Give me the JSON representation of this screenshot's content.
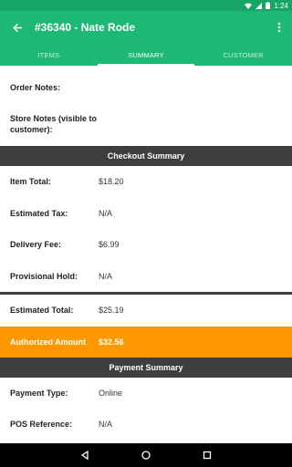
{
  "status_bar": {
    "time": "1:24"
  },
  "app_bar": {
    "title": "#36340 - Nate Rode"
  },
  "tabs": [
    {
      "label": "ITEMS"
    },
    {
      "label": "SUMMARY"
    },
    {
      "label": "CUSTOMER"
    }
  ],
  "notes": {
    "order_notes_label": "Order Notes:",
    "store_notes_label": "Store Notes (visible to customer):"
  },
  "checkout_summary": {
    "header": "Checkout Summary",
    "rows": [
      {
        "label": "Item Total:",
        "value": "$18.20"
      },
      {
        "label": "Estimated Tax:",
        "value": "N/A"
      },
      {
        "label": "Delivery Fee:",
        "value": "$6.99"
      },
      {
        "label": "Provisional Hold:",
        "value": "N/A"
      }
    ],
    "estimated_total": {
      "label": "Estimated Total:",
      "value": "$25.19"
    },
    "authorized": {
      "label": "Authorized Amount",
      "value": "$32.56"
    }
  },
  "payment_summary": {
    "header": "Payment Summary",
    "rows": [
      {
        "label": "Payment Type:",
        "value": "Online"
      },
      {
        "label": "POS Reference:",
        "value": "N/A"
      }
    ]
  },
  "colors": {
    "primary": "#1db874",
    "primary_dark": "#15a565",
    "accent": "#ff9800",
    "header": "#3e3e3e"
  }
}
